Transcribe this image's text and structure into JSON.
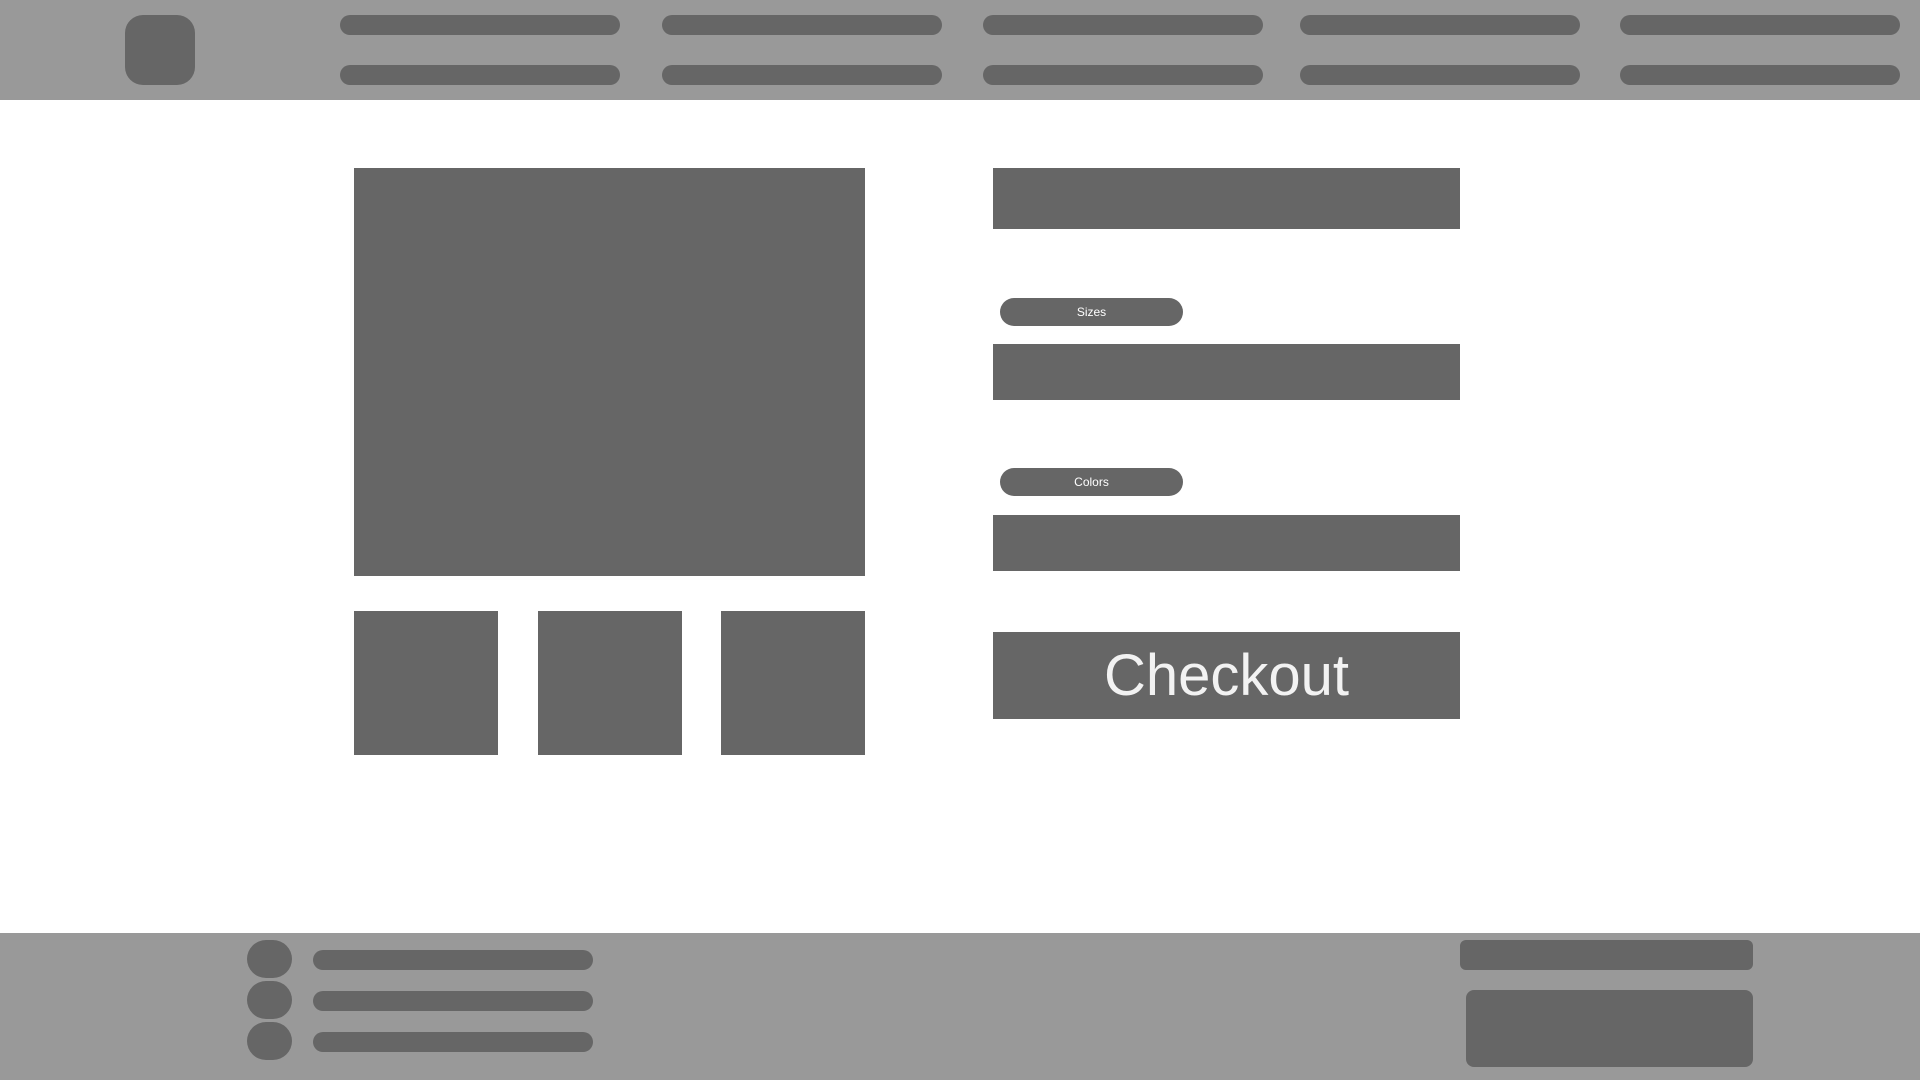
{
  "colors": {
    "bar": "#999999",
    "block": "#666666",
    "background": "#ffffff",
    "label_text": "#ffffff"
  },
  "product": {
    "sizes_label": "Sizes",
    "colors_label": "Colors",
    "checkout_label": "Checkout"
  }
}
